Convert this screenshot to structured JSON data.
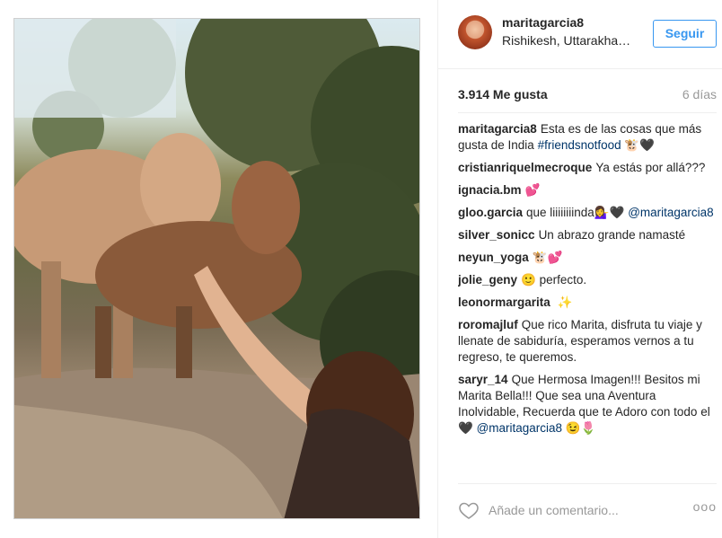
{
  "post": {
    "image_alt": "Photo of a woman feeding cows in the forest"
  },
  "header": {
    "username": "maritagarcia8",
    "location": "Rishikesh, Uttarakha…",
    "follow_label": "Seguir"
  },
  "stats": {
    "likes": "3.914 Me gusta",
    "age": "6 días"
  },
  "comments": [
    {
      "user": "maritagarcia8",
      "parts": [
        {
          "t": "Esta es de las cosas que más gusta de India "
        },
        {
          "t": "#friendsnotfood",
          "k": "hashtag"
        },
        {
          "t": " 🐮🖤"
        }
      ]
    },
    {
      "user": "cristianriquelmecroque",
      "parts": [
        {
          "t": "Ya estás por allá???"
        }
      ]
    },
    {
      "user": "ignacia.bm",
      "parts": [
        {
          "t": "💕"
        }
      ]
    },
    {
      "user": "gloo.garcia",
      "parts": [
        {
          "t": "que liiiiiiiinda💁‍♀️🖤 "
        },
        {
          "t": "@maritagarcia8",
          "k": "mention"
        }
      ]
    },
    {
      "user": "silver_sonicc",
      "parts": [
        {
          "t": "Un abrazo grande namasté"
        }
      ]
    },
    {
      "user": "neyun_yoga",
      "parts": [
        {
          "t": "🐮💕"
        }
      ]
    },
    {
      "user": "jolie_geny",
      "parts": [
        {
          "t": "🙂 perfecto."
        }
      ]
    },
    {
      "user": "leonormargarita",
      "parts": [
        {
          "t": "   ✨"
        }
      ]
    },
    {
      "user": "roromajluf",
      "parts": [
        {
          "t": "Que rico Marita, disfruta tu viaje y llenate de sabiduría, esperamos vernos a tu regreso, te queremos."
        }
      ]
    },
    {
      "user": "saryr_14",
      "parts": [
        {
          "t": "Que Hermosa Imagen!!! Besitos mi Marita Bella!!! Que sea una Aventura Inolvidable, Recuerda que te Adoro con todo el 🖤 "
        },
        {
          "t": "@maritagarcia8",
          "k": "mention"
        },
        {
          "t": " 😉🌷"
        }
      ]
    }
  ],
  "footer": {
    "add_comment_placeholder": "Añade un comentario...",
    "more_label": "ooo"
  },
  "icons": {
    "like": "heart-outline-icon",
    "more": "more-options-icon"
  },
  "colors": {
    "accent": "#3897f0",
    "text": "#262626",
    "muted": "#999999",
    "link": "#003569",
    "border": "#efefef"
  }
}
